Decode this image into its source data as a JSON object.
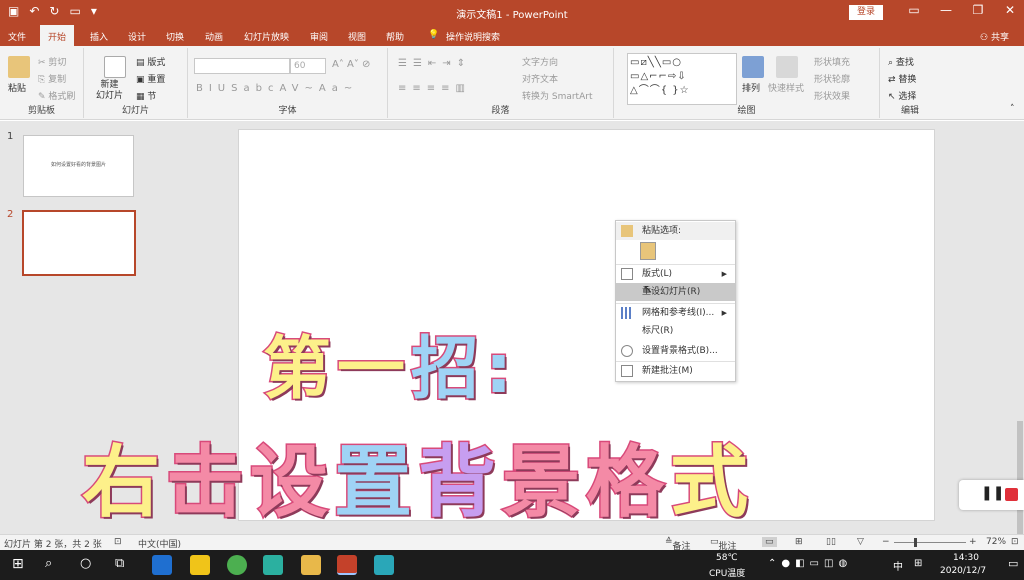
{
  "titlebar": {
    "doc_title": "演示文稿1  -  PowerPoint",
    "login": "登录"
  },
  "menu": {
    "tabs": [
      "文件",
      "开始",
      "插入",
      "设计",
      "切换",
      "动画",
      "幻灯片放映",
      "审阅",
      "视图",
      "帮助"
    ],
    "active_tab": "开始",
    "tell_me": "操作说明搜索",
    "share": "共享"
  },
  "ribbon": {
    "clipboard": {
      "label": "剪贴板",
      "paste": "粘贴",
      "cut": "剪切",
      "copy": "复制",
      "format_painter": "格式刷"
    },
    "slides": {
      "label": "幻灯片",
      "new_slide": "新建\n幻灯片",
      "layout": "版式",
      "reset": "重置",
      "section": "节"
    },
    "font": {
      "label": "字体",
      "size": "60"
    },
    "paragraph": {
      "label": "段落",
      "text_direction": "文字方向",
      "align_text": "对齐文本",
      "smartart": "转换为 SmartArt"
    },
    "drawing": {
      "label": "绘图",
      "arrange": "排列",
      "quick_styles": "快速样式",
      "shape_fill": "形状填充",
      "shape_outline": "形状轮廓",
      "shape_effects": "形状效果"
    },
    "editing": {
      "label": "编辑",
      "find": "查找",
      "replace": "替换",
      "select": "选择"
    }
  },
  "slides_panel": {
    "thumb1_num": "1",
    "thumb1_text": "如何设置好看的背景图片",
    "thumb2_num": "2"
  },
  "context_menu": {
    "paste_options": "粘贴选项:",
    "layout": "版式(L)",
    "reset_slide": "重设幻灯片(R)",
    "grid": "网格和参考线(I)...",
    "ruler": "标尺(R)",
    "format_background": "设置背景格式(B)...",
    "new_comment": "新建批注(M)"
  },
  "overlay": {
    "line1": [
      "第",
      "一",
      "招",
      ":"
    ],
    "line2": [
      "右",
      "击",
      "设",
      "置",
      "背",
      "景",
      "格",
      "式"
    ],
    "colors": [
      "#fdf08a",
      "#f48aa6",
      "#9fd3f5",
      "#c79ef0"
    ]
  },
  "statusbar": {
    "slide_info": "幻灯片 第 2 张，共 2 张",
    "language": "中文(中国)",
    "notes": "备注",
    "comments": "批注",
    "zoom": "72%"
  },
  "taskbar": {
    "weather": "58℃",
    "cpu": "CPU温度",
    "ime": "中",
    "time": "14:30",
    "date": "2020/12/7"
  }
}
